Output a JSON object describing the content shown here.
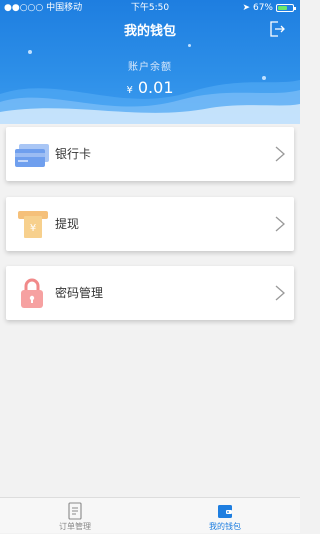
{
  "status_bar": {
    "carrier": "●●○○○ 中国移动",
    "time": "下午5:50",
    "battery": "67%",
    "battery_level": 0.67
  },
  "header": {
    "title": "我的钱包",
    "logout_icon": "logout-icon"
  },
  "balance": {
    "label": "账户余额",
    "currency": "¥",
    "amount": "0.01"
  },
  "menu": [
    {
      "label": "银行卡",
      "icon": "bank-card-icon"
    },
    {
      "label": "提现",
      "icon": "withdraw-icon"
    },
    {
      "label": "密码管理",
      "icon": "lock-icon"
    }
  ],
  "tabbar": [
    {
      "label": "订单管理",
      "icon": "orders-icon",
      "active": false
    },
    {
      "label": "我的钱包",
      "icon": "wallet-icon",
      "active": true
    }
  ],
  "colors": {
    "primary": "#1e7ee0",
    "background": "#f2f2f2"
  }
}
